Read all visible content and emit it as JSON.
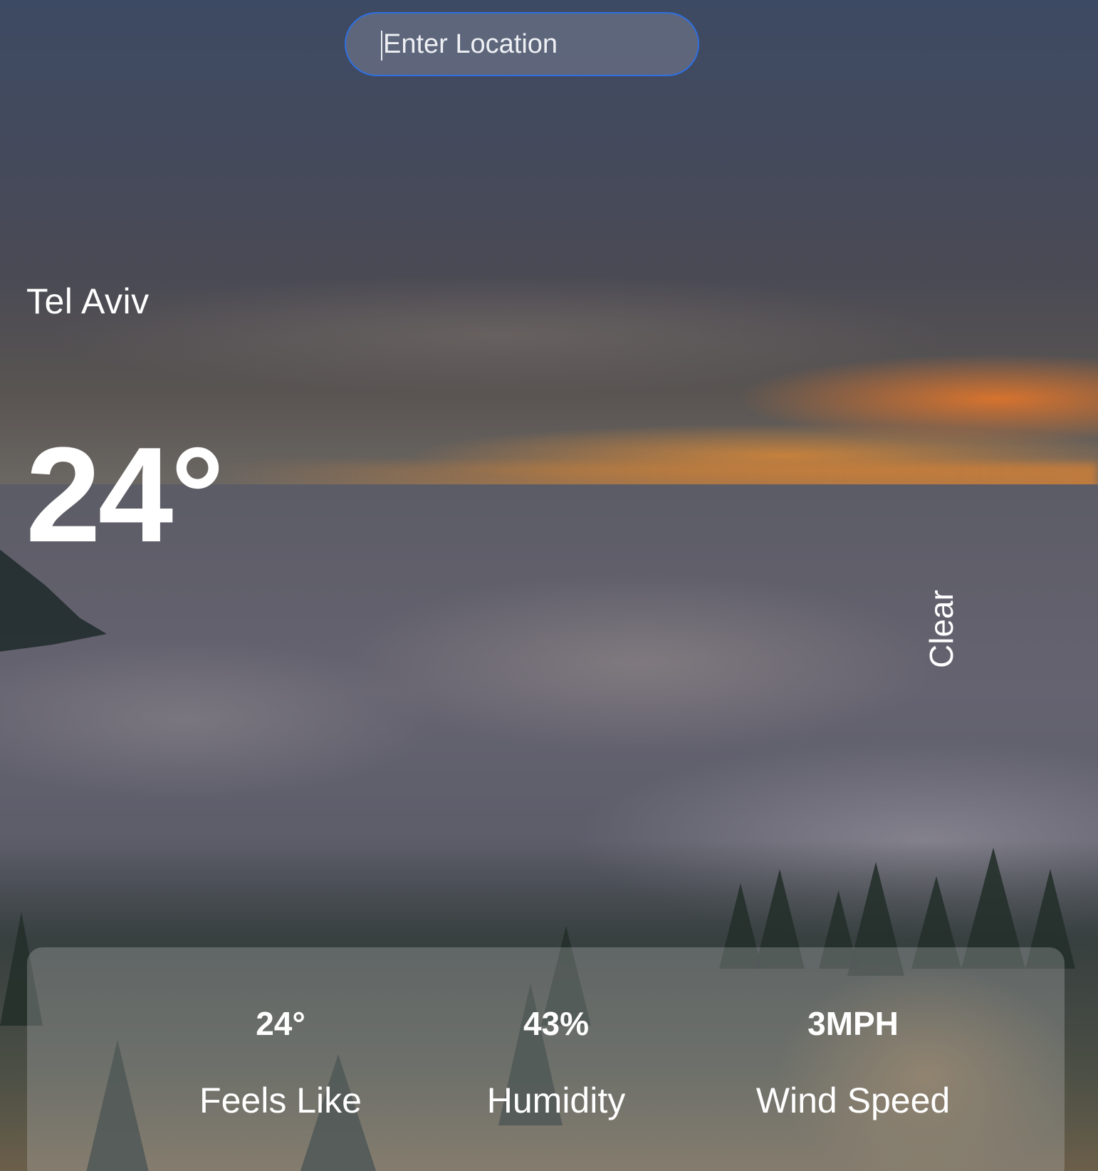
{
  "search": {
    "placeholder": "Enter Location",
    "value": ""
  },
  "location": {
    "city": "Tel Aviv"
  },
  "current": {
    "temperature": "24°",
    "condition": "Clear"
  },
  "details": [
    {
      "value": "24°",
      "label": "Feels Like"
    },
    {
      "value": "43%",
      "label": "Humidity"
    },
    {
      "value": "3MPH",
      "label": "Wind Speed"
    }
  ],
  "colors": {
    "input_border": "#2f6fe0",
    "text": "#ffffff",
    "panel": "rgba(200,200,205,0.28)"
  }
}
